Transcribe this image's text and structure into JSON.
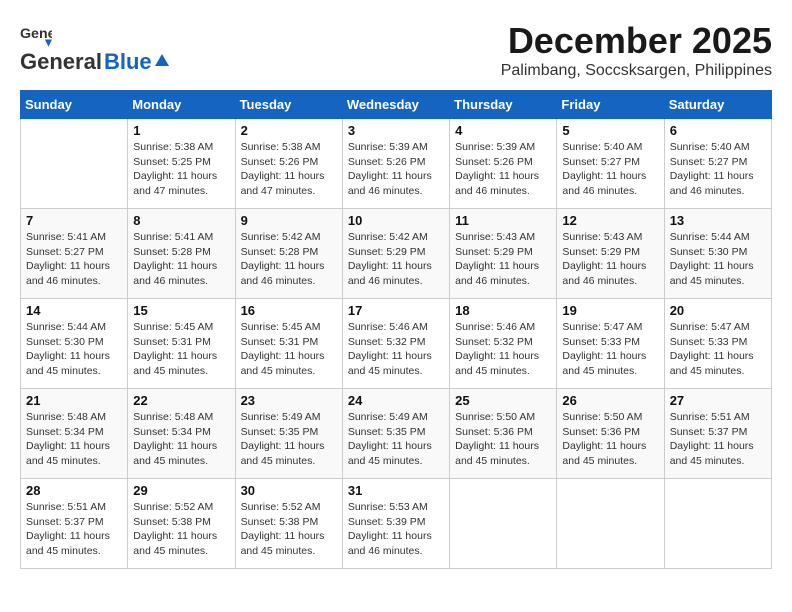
{
  "logo": {
    "general": "General",
    "blue": "Blue"
  },
  "title": "December 2025",
  "location": "Palimbang, Soccsksargen, Philippines",
  "weekdays": [
    "Sunday",
    "Monday",
    "Tuesday",
    "Wednesday",
    "Thursday",
    "Friday",
    "Saturday"
  ],
  "weeks": [
    [
      {
        "day": "",
        "info": ""
      },
      {
        "day": "1",
        "info": "Sunrise: 5:38 AM\nSunset: 5:25 PM\nDaylight: 11 hours\nand 47 minutes."
      },
      {
        "day": "2",
        "info": "Sunrise: 5:38 AM\nSunset: 5:26 PM\nDaylight: 11 hours\nand 47 minutes."
      },
      {
        "day": "3",
        "info": "Sunrise: 5:39 AM\nSunset: 5:26 PM\nDaylight: 11 hours\nand 46 minutes."
      },
      {
        "day": "4",
        "info": "Sunrise: 5:39 AM\nSunset: 5:26 PM\nDaylight: 11 hours\nand 46 minutes."
      },
      {
        "day": "5",
        "info": "Sunrise: 5:40 AM\nSunset: 5:27 PM\nDaylight: 11 hours\nand 46 minutes."
      },
      {
        "day": "6",
        "info": "Sunrise: 5:40 AM\nSunset: 5:27 PM\nDaylight: 11 hours\nand 46 minutes."
      }
    ],
    [
      {
        "day": "7",
        "info": "Sunrise: 5:41 AM\nSunset: 5:27 PM\nDaylight: 11 hours\nand 46 minutes."
      },
      {
        "day": "8",
        "info": "Sunrise: 5:41 AM\nSunset: 5:28 PM\nDaylight: 11 hours\nand 46 minutes."
      },
      {
        "day": "9",
        "info": "Sunrise: 5:42 AM\nSunset: 5:28 PM\nDaylight: 11 hours\nand 46 minutes."
      },
      {
        "day": "10",
        "info": "Sunrise: 5:42 AM\nSunset: 5:29 PM\nDaylight: 11 hours\nand 46 minutes."
      },
      {
        "day": "11",
        "info": "Sunrise: 5:43 AM\nSunset: 5:29 PM\nDaylight: 11 hours\nand 46 minutes."
      },
      {
        "day": "12",
        "info": "Sunrise: 5:43 AM\nSunset: 5:29 PM\nDaylight: 11 hours\nand 46 minutes."
      },
      {
        "day": "13",
        "info": "Sunrise: 5:44 AM\nSunset: 5:30 PM\nDaylight: 11 hours\nand 45 minutes."
      }
    ],
    [
      {
        "day": "14",
        "info": "Sunrise: 5:44 AM\nSunset: 5:30 PM\nDaylight: 11 hours\nand 45 minutes."
      },
      {
        "day": "15",
        "info": "Sunrise: 5:45 AM\nSunset: 5:31 PM\nDaylight: 11 hours\nand 45 minutes."
      },
      {
        "day": "16",
        "info": "Sunrise: 5:45 AM\nSunset: 5:31 PM\nDaylight: 11 hours\nand 45 minutes."
      },
      {
        "day": "17",
        "info": "Sunrise: 5:46 AM\nSunset: 5:32 PM\nDaylight: 11 hours\nand 45 minutes."
      },
      {
        "day": "18",
        "info": "Sunrise: 5:46 AM\nSunset: 5:32 PM\nDaylight: 11 hours\nand 45 minutes."
      },
      {
        "day": "19",
        "info": "Sunrise: 5:47 AM\nSunset: 5:33 PM\nDaylight: 11 hours\nand 45 minutes."
      },
      {
        "day": "20",
        "info": "Sunrise: 5:47 AM\nSunset: 5:33 PM\nDaylight: 11 hours\nand 45 minutes."
      }
    ],
    [
      {
        "day": "21",
        "info": "Sunrise: 5:48 AM\nSunset: 5:34 PM\nDaylight: 11 hours\nand 45 minutes."
      },
      {
        "day": "22",
        "info": "Sunrise: 5:48 AM\nSunset: 5:34 PM\nDaylight: 11 hours\nand 45 minutes."
      },
      {
        "day": "23",
        "info": "Sunrise: 5:49 AM\nSunset: 5:35 PM\nDaylight: 11 hours\nand 45 minutes."
      },
      {
        "day": "24",
        "info": "Sunrise: 5:49 AM\nSunset: 5:35 PM\nDaylight: 11 hours\nand 45 minutes."
      },
      {
        "day": "25",
        "info": "Sunrise: 5:50 AM\nSunset: 5:36 PM\nDaylight: 11 hours\nand 45 minutes."
      },
      {
        "day": "26",
        "info": "Sunrise: 5:50 AM\nSunset: 5:36 PM\nDaylight: 11 hours\nand 45 minutes."
      },
      {
        "day": "27",
        "info": "Sunrise: 5:51 AM\nSunset: 5:37 PM\nDaylight: 11 hours\nand 45 minutes."
      }
    ],
    [
      {
        "day": "28",
        "info": "Sunrise: 5:51 AM\nSunset: 5:37 PM\nDaylight: 11 hours\nand 45 minutes."
      },
      {
        "day": "29",
        "info": "Sunrise: 5:52 AM\nSunset: 5:38 PM\nDaylight: 11 hours\nand 45 minutes."
      },
      {
        "day": "30",
        "info": "Sunrise: 5:52 AM\nSunset: 5:38 PM\nDaylight: 11 hours\nand 45 minutes."
      },
      {
        "day": "31",
        "info": "Sunrise: 5:53 AM\nSunset: 5:39 PM\nDaylight: 11 hours\nand 46 minutes."
      },
      {
        "day": "",
        "info": ""
      },
      {
        "day": "",
        "info": ""
      },
      {
        "day": "",
        "info": ""
      }
    ]
  ]
}
